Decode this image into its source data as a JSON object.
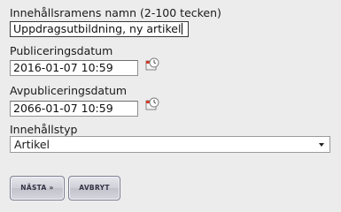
{
  "form": {
    "name_label": "Innehållsramens namn (2-100 tecken)",
    "name_value": "Uppdragsutbildning, ny artikel",
    "publish_label": "Publiceringsdatum",
    "publish_value": "2016-01-07 10:59",
    "unpublish_label": "Avpubliceringsdatum",
    "unpublish_value": "2066-01-07 10:59",
    "type_label": "Innehållstyp",
    "type_selected": "Artikel"
  },
  "buttons": {
    "next_label": "NÄSTA »",
    "cancel_label": "AVBRYT"
  },
  "icons": {
    "calendar": "calendar-clock-icon"
  },
  "colors": {
    "background": "#ececec",
    "button_border": "#7e7e92",
    "button_text": "#333344"
  }
}
